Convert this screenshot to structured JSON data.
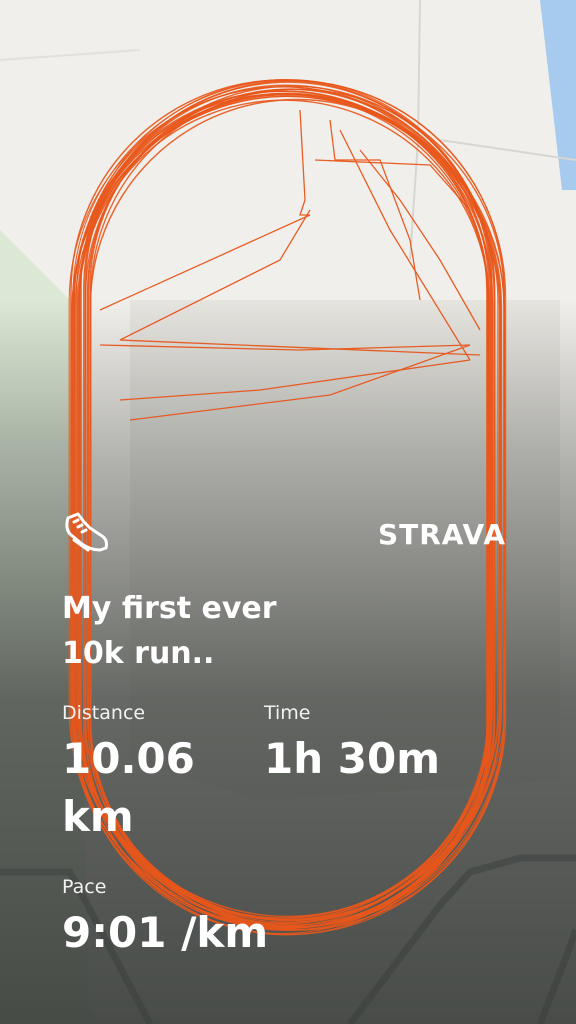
{
  "activity": {
    "title_line1": "My first ever",
    "title_line2": "10k run..",
    "icon": "running-shoe-icon"
  },
  "brand": {
    "name": "STRAVA"
  },
  "stats": {
    "distance_label": "Distance",
    "distance_value": "10.06",
    "distance_unit": "km",
    "time_label": "Time",
    "time_value": "1h 30m",
    "pace_label": "Pace",
    "pace_value": "9:01 /km"
  },
  "colors": {
    "route": "#e8561b",
    "map_land": "#f1efeb",
    "map_park": "#dbe8d5",
    "map_water": "#a6cbee",
    "map_road": "#8e9297"
  }
}
